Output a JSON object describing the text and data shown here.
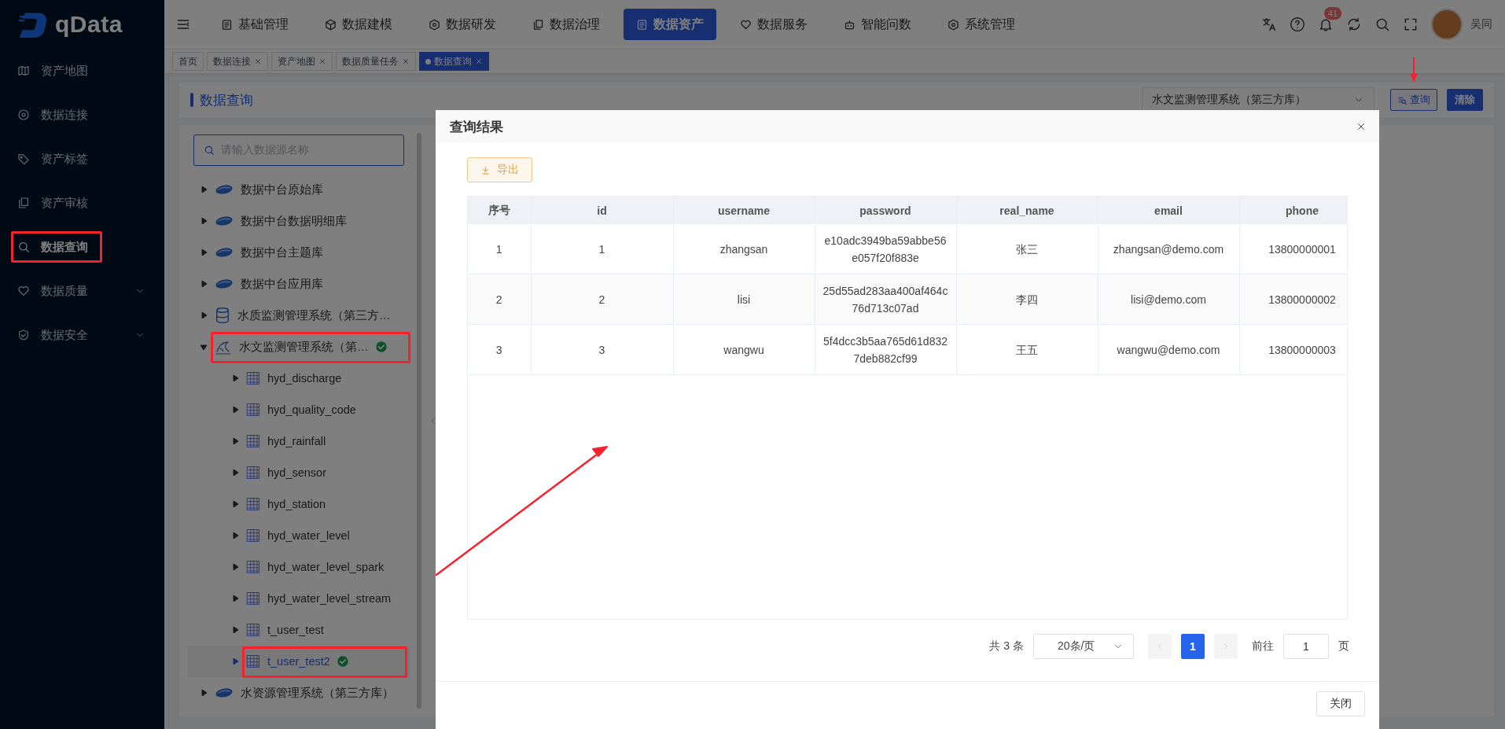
{
  "logo": {
    "text": "qData"
  },
  "sidebar": {
    "items": [
      {
        "label": "资产地图",
        "selected": false,
        "expandable": false,
        "annotated": false
      },
      {
        "label": "数据连接",
        "selected": false,
        "expandable": false,
        "annotated": false
      },
      {
        "label": "资产标签",
        "selected": false,
        "expandable": false,
        "annotated": false
      },
      {
        "label": "资产审核",
        "selected": false,
        "expandable": false,
        "annotated": false
      },
      {
        "label": "数据查询",
        "selected": true,
        "expandable": false,
        "annotated": true
      },
      {
        "label": "数据质量",
        "selected": false,
        "expandable": true,
        "annotated": false
      },
      {
        "label": "数据安全",
        "selected": false,
        "expandable": true,
        "annotated": false
      }
    ]
  },
  "top_nav": {
    "items": [
      {
        "label": "基础管理",
        "selected": false
      },
      {
        "label": "数据建模",
        "selected": false
      },
      {
        "label": "数据研发",
        "selected": false
      },
      {
        "label": "数据治理",
        "selected": false
      },
      {
        "label": "数据资产",
        "selected": true
      },
      {
        "label": "数据服务",
        "selected": false
      },
      {
        "label": "智能问数",
        "selected": false
      },
      {
        "label": "系统管理",
        "selected": false
      }
    ]
  },
  "header_actions": {
    "notification_count": "41",
    "user_name": "吴同"
  },
  "tabs": [
    {
      "label": "首页",
      "closable": false,
      "selected": false
    },
    {
      "label": "数据连接",
      "closable": true,
      "selected": false
    },
    {
      "label": "资产地图",
      "closable": true,
      "selected": false
    },
    {
      "label": "数据质量任务",
      "closable": true,
      "selected": false
    },
    {
      "label": "数据查询",
      "closable": true,
      "selected": true
    }
  ],
  "page": {
    "title": "数据查询",
    "datasource_select": {
      "value": "水文监测管理系统（第三方库）"
    },
    "query_button": {
      "label": "查询",
      "annotated": true
    },
    "clear_button": {
      "label": "清除"
    }
  },
  "tree": {
    "search": {
      "placeholder": "请输入数据源名称"
    },
    "nodes": [
      {
        "label": "数据中台原始库",
        "kind": "cloud",
        "expanded": false,
        "selected": false,
        "connected": false,
        "annotated": false
      },
      {
        "label": "数据中台数据明细库",
        "kind": "cloud",
        "expanded": false,
        "selected": false,
        "connected": false,
        "annotated": false
      },
      {
        "label": "数据中台主题库",
        "kind": "cloud",
        "expanded": false,
        "selected": false,
        "connected": false,
        "annotated": false
      },
      {
        "label": "数据中台应用库",
        "kind": "cloud",
        "expanded": false,
        "selected": false,
        "connected": false,
        "annotated": false
      },
      {
        "label": "水质监测管理系统（第三方…",
        "kind": "database",
        "expanded": false,
        "selected": false,
        "connected": false,
        "annotated": false
      },
      {
        "label": "水文监测管理系统（第…",
        "kind": "mysql",
        "expanded": true,
        "selected": false,
        "connected": true,
        "annotated": true,
        "children": [
          {
            "label": "hyd_discharge",
            "kind": "table",
            "expanded": false,
            "selected": false,
            "connected": false,
            "annotated": false
          },
          {
            "label": "hyd_quality_code",
            "kind": "table",
            "expanded": false,
            "selected": false,
            "connected": false,
            "annotated": false
          },
          {
            "label": "hyd_rainfall",
            "kind": "table",
            "expanded": false,
            "selected": false,
            "connected": false,
            "annotated": false
          },
          {
            "label": "hyd_sensor",
            "kind": "table",
            "expanded": false,
            "selected": false,
            "connected": false,
            "annotated": false
          },
          {
            "label": "hyd_station",
            "kind": "table",
            "expanded": false,
            "selected": false,
            "connected": false,
            "annotated": false
          },
          {
            "label": "hyd_water_level",
            "kind": "table",
            "expanded": false,
            "selected": false,
            "connected": false,
            "annotated": false
          },
          {
            "label": "hyd_water_level_spark",
            "kind": "table",
            "expanded": false,
            "selected": false,
            "connected": false,
            "annotated": false
          },
          {
            "label": "hyd_water_level_stream",
            "kind": "table",
            "expanded": false,
            "selected": false,
            "connected": false,
            "annotated": false
          },
          {
            "label": "t_user_test",
            "kind": "table",
            "expanded": false,
            "selected": false,
            "connected": false,
            "annotated": false
          },
          {
            "label": "t_user_test2",
            "kind": "table",
            "expanded": false,
            "selected": true,
            "connected": true,
            "annotated": true
          }
        ]
      },
      {
        "label": "水资源管理系统（第三方库）",
        "kind": "cloud",
        "expanded": false,
        "selected": false,
        "connected": false,
        "annotated": false
      }
    ]
  },
  "dialog": {
    "title": "查询结果",
    "export_button": "导出",
    "annotation_arrow": true,
    "table": {
      "columns": [
        "序号",
        "id",
        "username",
        "password",
        "real_name",
        "email",
        "phone"
      ],
      "rows": [
        [
          "1",
          "1",
          "zhangsan",
          "e10adc3949ba59abbe56e057f20f883e",
          "张三",
          "zhangsan@demo.com",
          "13800000001"
        ],
        [
          "2",
          "2",
          "lisi",
          "25d55ad283aa400af464c76d713c07ad",
          "李四",
          "lisi@demo.com",
          "13800000002"
        ],
        [
          "3",
          "3",
          "wangwu",
          "5f4dcc3b5aa765d61d8327deb882cf99",
          "王五",
          "wangwu@demo.com",
          "13800000003"
        ]
      ]
    },
    "pagination": {
      "total": "共 3 条",
      "page_size": "20条/页",
      "pages": [
        {
          "label": "1",
          "selected": true
        }
      ],
      "goto_label": "前往",
      "goto_value": "1",
      "page_suffix": "页"
    },
    "close_button": "关闭"
  }
}
